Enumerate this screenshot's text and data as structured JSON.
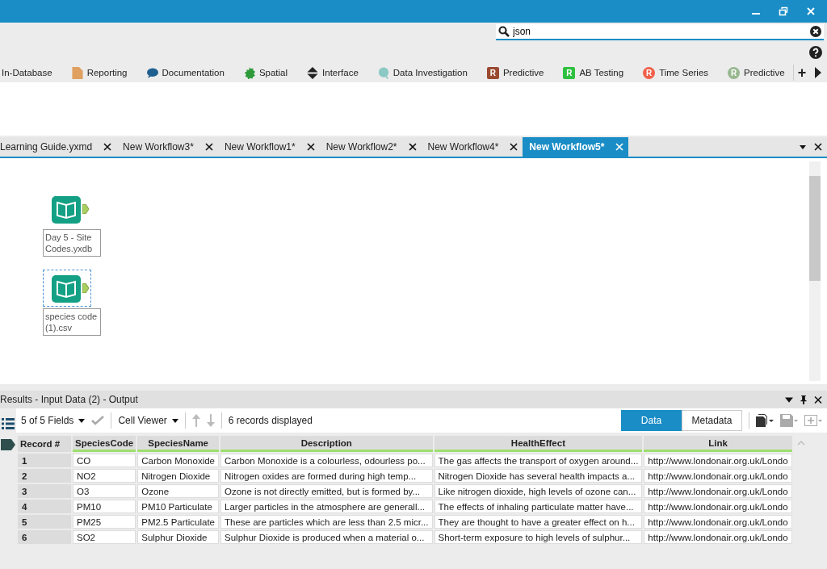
{
  "search": {
    "value": "json"
  },
  "categories": [
    {
      "label": "In-Database",
      "kind": "none"
    },
    {
      "label": "Reporting",
      "kind": "doc",
      "color": "#e0a060"
    },
    {
      "label": "Documentation",
      "kind": "bubble",
      "color": "#1f5f8f"
    },
    {
      "label": "Spatial",
      "kind": "blob",
      "color": "#2e9a3a"
    },
    {
      "label": "Interface",
      "kind": "arrows",
      "color": "#222222"
    },
    {
      "label": "Data Investigation",
      "kind": "circle",
      "color": "#8cc8c4"
    },
    {
      "label": "Predictive",
      "kind": "r-square",
      "color": "#9a4a30",
      "badge": "R"
    },
    {
      "label": "AB Testing",
      "kind": "r-square",
      "color": "#2ec040",
      "badge": "R"
    },
    {
      "label": "Time Series",
      "kind": "r-circle",
      "color": "#f0604a",
      "badge": "R"
    },
    {
      "label": "Predictive",
      "kind": "r-circle",
      "color": "#98b890",
      "badge": "R"
    }
  ],
  "add_button": "+",
  "doc_tabs": [
    {
      "label": "Learning Guide.yxmd",
      "selected": false
    },
    {
      "label": "New Workflow3*",
      "selected": false
    },
    {
      "label": "New Workflow1*",
      "selected": false
    },
    {
      "label": "New Workflow2*",
      "selected": false
    },
    {
      "label": "New Workflow4*",
      "selected": false
    },
    {
      "label": "New Workflow5*",
      "selected": true
    }
  ],
  "nodes": [
    {
      "label": "Day 5 - Site Codes.yxdb",
      "selected": false
    },
    {
      "label": "species code (1).csv",
      "selected": true
    }
  ],
  "results": {
    "title": "Results - Input Data (2) - Output",
    "fields": "5 of 5 Fields",
    "viewer": "Cell Viewer",
    "count": "6 records displayed",
    "views": [
      {
        "label": "Data",
        "selected": true
      },
      {
        "label": "Metadata",
        "selected": false
      }
    ]
  },
  "table": {
    "columns": [
      "Record #",
      "SpeciesCode",
      "SpeciesName",
      "Description",
      "HealthEffect",
      "Link"
    ],
    "rows": [
      [
        "1",
        "CO",
        "Carbon Monoxide",
        "Carbon Monoxide is a colourless, odourless po...",
        "The gas affects the transport of oxygen around...",
        "http://www.londonair.org.uk/Londo"
      ],
      [
        "2",
        "NO2",
        "Nitrogen Dioxide",
        "Nitrogen oxides are formed during high temp...",
        "Nitrogen Dioxide has several health impacts a...",
        "http://www.londonair.org.uk/Londo"
      ],
      [
        "3",
        "O3",
        "Ozone",
        "Ozone is not directly emitted, but is formed by...",
        "Like nitrogen dioxide, high levels of ozone can...",
        "http://www.londonair.org.uk/Londo"
      ],
      [
        "4",
        "PM10",
        "PM10 Particulate",
        "Larger particles in the atmosphere are generall...",
        "The effects of inhaling particulate matter have...",
        "http://www.londonair.org.uk/Londo"
      ],
      [
        "5",
        "PM25",
        "PM2.5 Particulate",
        "These are particles which are less than 2.5 micr...",
        "They are thought to have a greater effect on h...",
        "http://www.londonair.org.uk/Londo"
      ],
      [
        "6",
        "SO2",
        "Sulphur Dioxide",
        "Sulphur Dioxide is produced when a material o...",
        "Short-term exposure to high levels of sulphur...",
        "http://www.londonair.org.uk/Londo"
      ]
    ]
  }
}
